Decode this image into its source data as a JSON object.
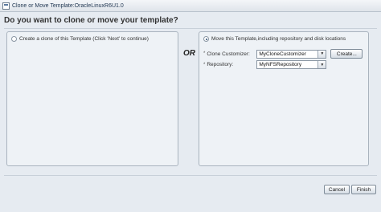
{
  "window": {
    "title": "Clone or Move Template:OracleLinuxR6U1.0"
  },
  "heading": "Do you want to clone or move your template?",
  "left_option": {
    "label": "Create a clone of this Template (Click 'Next' to continue)",
    "selected": false
  },
  "or_label": "OR",
  "right_option": {
    "label": "Move this Template,including repository and disk locations",
    "selected": true,
    "clone_customizer": {
      "label": "Clone Customizer:",
      "value": "MyCloneCustomizer",
      "create_label": "Create..."
    },
    "repository": {
      "label": "Repository:",
      "value": "MyNFSRepository"
    }
  },
  "buttons": {
    "cancel": "Cancel",
    "finish": "Finish"
  }
}
